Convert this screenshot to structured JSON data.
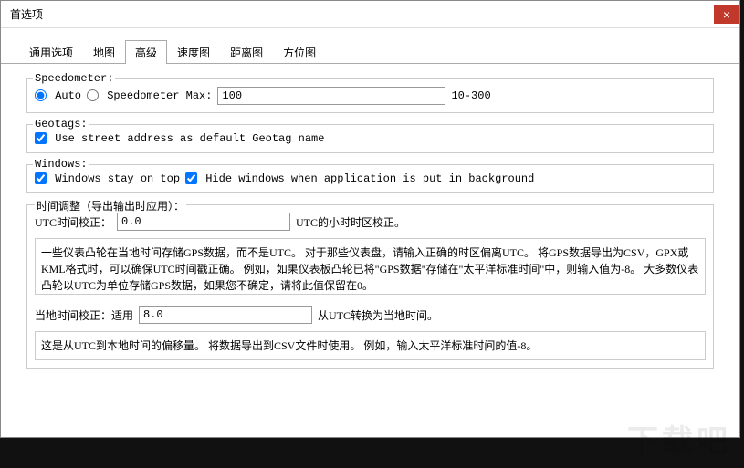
{
  "titlebar": {
    "title": "首选项",
    "close": "×"
  },
  "tabs": [
    "通用选项",
    "地图",
    "高级",
    "速度图",
    "距离图",
    "方位图"
  ],
  "active_tab": 2,
  "speedometer": {
    "legend": "Speedometer:",
    "auto": "Auto",
    "max_label": "Speedometer Max:",
    "max_value": "100",
    "range_hint": "10-300",
    "auto_selected": true
  },
  "geotags": {
    "legend": "Geotags:",
    "use_street": "Use street address as default Geotag name",
    "use_street_checked": true
  },
  "windows": {
    "legend": "Windows:",
    "stay_top": "Windows stay on top",
    "stay_top_checked": true,
    "hide_bg": "Hide windows when application is put in background",
    "hide_bg_checked": true
  },
  "time_adjust": {
    "legend": "时间调整（导出输出时应用）：",
    "utc_label": "UTC时间校正：",
    "utc_value": "0.0",
    "utc_hint": "UTC的小时时区校正。",
    "utc_desc": "一些仪表凸轮在当地时间存储GPS数据，而不是UTC。 对于那些仪表盘，请输入正确的时区偏离UTC。 将GPS数据导出为CSV，GPX或KML格式时，可以确保UTC时间戳正确。 例如，如果仪表板凸轮已将\"GPS数据\"存储在\"太平洋标准时间\"中，则输入值为-8。 大多数仪表凸轮以UTC为单位存储GPS数据，如果您不确定，请将此值保留在0。",
    "local_label": "当地时间校正：适用",
    "local_value": "8.0",
    "local_hint": "从UTC转换为当地时间。",
    "local_desc": "这是从UTC到本地时间的偏移量。 将数据导出到CSV文件时使用。 例如，输入太平洋标准时间的值-8。"
  },
  "watermark": "下载吧"
}
